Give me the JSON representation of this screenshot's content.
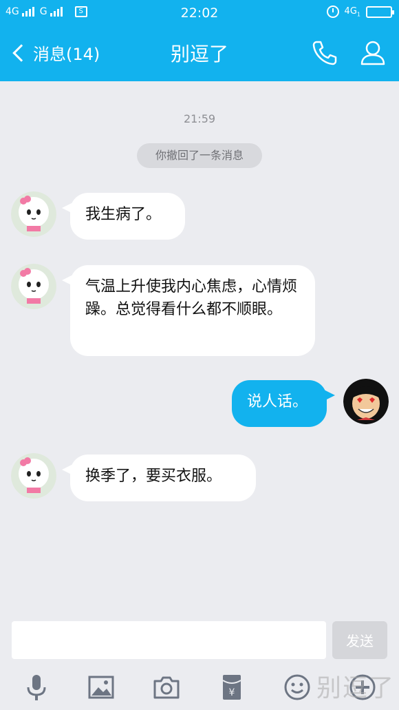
{
  "status_bar": {
    "net1": "4G",
    "net2": "G",
    "time": "22:02",
    "net3": "4G",
    "net3_sub": "1"
  },
  "nav": {
    "back_label": "消息(14)",
    "title": "别逗了"
  },
  "chat": {
    "timestamp": "21:59",
    "system_notice": "你撤回了一条消息",
    "messages": [
      {
        "from": "other",
        "text": "我生病了。"
      },
      {
        "from": "other",
        "text": "气温上升使我内心焦虑，心情烦躁。总觉得看什么都不顺眼。"
      },
      {
        "from": "me",
        "text": "说人话。"
      },
      {
        "from": "other",
        "text": "换季了，要买衣服。"
      }
    ]
  },
  "input": {
    "value": "",
    "placeholder": "",
    "send_label": "发送"
  },
  "toolbar": [
    "microphone-icon",
    "image-icon",
    "camera-icon",
    "red-packet-icon",
    "emoji-icon",
    "plus-icon"
  ],
  "watermark": "别逗了",
  "colors": {
    "accent": "#12b2ee",
    "background": "#ebecf0",
    "bubble_other": "#ffffff",
    "bubble_me": "#12b2ee"
  }
}
